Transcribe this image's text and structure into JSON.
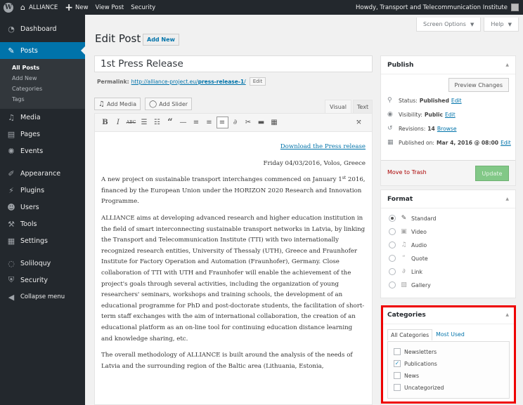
{
  "adminbar": {
    "wp_logo": "W",
    "site_name": "ALLIANCE",
    "new_label": "New",
    "view_post": "View Post",
    "security": "Security",
    "howdy": "Howdy, Transport and Telecommunication Institute"
  },
  "sidebar": {
    "items": [
      {
        "label": "Dashboard",
        "icon": "dashboard-icon"
      },
      {
        "label": "Posts",
        "icon": "pin-icon"
      },
      {
        "label": "Media",
        "icon": "media-icon"
      },
      {
        "label": "Pages",
        "icon": "pages-icon"
      },
      {
        "label": "Events",
        "icon": "events-icon"
      },
      {
        "label": "Appearance",
        "icon": "appearance-icon"
      },
      {
        "label": "Plugins",
        "icon": "plugins-icon"
      },
      {
        "label": "Users",
        "icon": "users-icon"
      },
      {
        "label": "Tools",
        "icon": "tools-icon"
      },
      {
        "label": "Settings",
        "icon": "settings-icon"
      },
      {
        "label": "Soliloquy",
        "icon": "soliloquy-icon"
      },
      {
        "label": "Security",
        "icon": "security-icon"
      },
      {
        "label": "Collapse menu",
        "icon": "collapse-icon"
      }
    ],
    "posts_submenu": [
      "All Posts",
      "Add New",
      "Categories",
      "Tags"
    ]
  },
  "screen_options": "Screen Options",
  "help": "Help",
  "page_title": "Edit Post",
  "add_new": "Add New",
  "post": {
    "title": "1st Press Release",
    "permalink_label": "Permalink:",
    "permalink_base": "http://alliance-project.eu/",
    "permalink_slug": "press-release-1",
    "permalink_end": "/",
    "permalink_edit": "Edit"
  },
  "editor": {
    "add_media": "Add Media",
    "add_slider": "Add Slider",
    "tab_visual": "Visual",
    "tab_text": "Text",
    "download_link": "Download the Press release",
    "dateline": "Friday 04/03/2016, Volos, Greece",
    "p1_a": "A new project on sustainable transport interchanges commenced on January 1",
    "p1_sup": "st",
    "p1_b": " 2016, financed by the European Union under the HORIZON 2020 Research and Innovation Programme.",
    "p2": "ALLIANCE aims at developing advanced research and higher education institution in the field of smart interconnecting sustainable transport networks in Latvia, by linking the Transport and Telecommunication Institute (TTI) with two internationally recognized research entities, University of Thessaly (UTH), Greece and Fraunhofer Institute for Factory Operation and Automation (Fraunhofer), Germany. Close collaboration of TTI with UTH and Fraunhofer will enable the achievement of the project's goals through several activities, including the organization of young researchers' seminars, workshops and training schools, the development of an educational programme for PhD and post-doctorate students, the facilitation of short-term staff exchanges with the aim of international collaboration, the creation of an educational platform as an on-line tool for continuing education distance learning and knowledge sharing, etc.",
    "p3": "The overall methodology of ALLIANCE is built around the analysis of the needs of Latvia and the surrounding region of the Baltic area (Lithuania, Estonia,"
  },
  "publish": {
    "heading": "Publish",
    "preview": "Preview Changes",
    "status_label": "Status:",
    "status_value": "Published",
    "visibility_label": "Visibility:",
    "visibility_value": "Public",
    "revisions_label": "Revisions:",
    "revisions_value": "14",
    "browse": "Browse",
    "published_label": "Published on:",
    "published_value": "Mar 4, 2016 @ 08:00",
    "edit": "Edit",
    "trash": "Move to Trash",
    "update": "Update"
  },
  "format": {
    "heading": "Format",
    "options": [
      {
        "label": "Standard",
        "icon": "pin-icon",
        "checked": true
      },
      {
        "label": "Video",
        "icon": "video-icon",
        "checked": false
      },
      {
        "label": "Audio",
        "icon": "audio-icon",
        "checked": false
      },
      {
        "label": "Quote",
        "icon": "quote-icon",
        "checked": false
      },
      {
        "label": "Link",
        "icon": "link-icon",
        "checked": false
      },
      {
        "label": "Gallery",
        "icon": "gallery-icon",
        "checked": false
      }
    ]
  },
  "categories": {
    "heading": "Categories",
    "tab_all": "All Categories",
    "tab_most": "Most Used",
    "items": [
      {
        "label": "Newsletters",
        "checked": false
      },
      {
        "label": "Publications",
        "checked": true
      },
      {
        "label": "News",
        "checked": false
      },
      {
        "label": "Uncategorized",
        "checked": false
      }
    ]
  },
  "colors": {
    "admin_dark": "#23282d",
    "accent_blue": "#0073aa",
    "highlight_red": "#ee0000",
    "update_green": "#82c887",
    "trash_red": "#aa0000"
  }
}
